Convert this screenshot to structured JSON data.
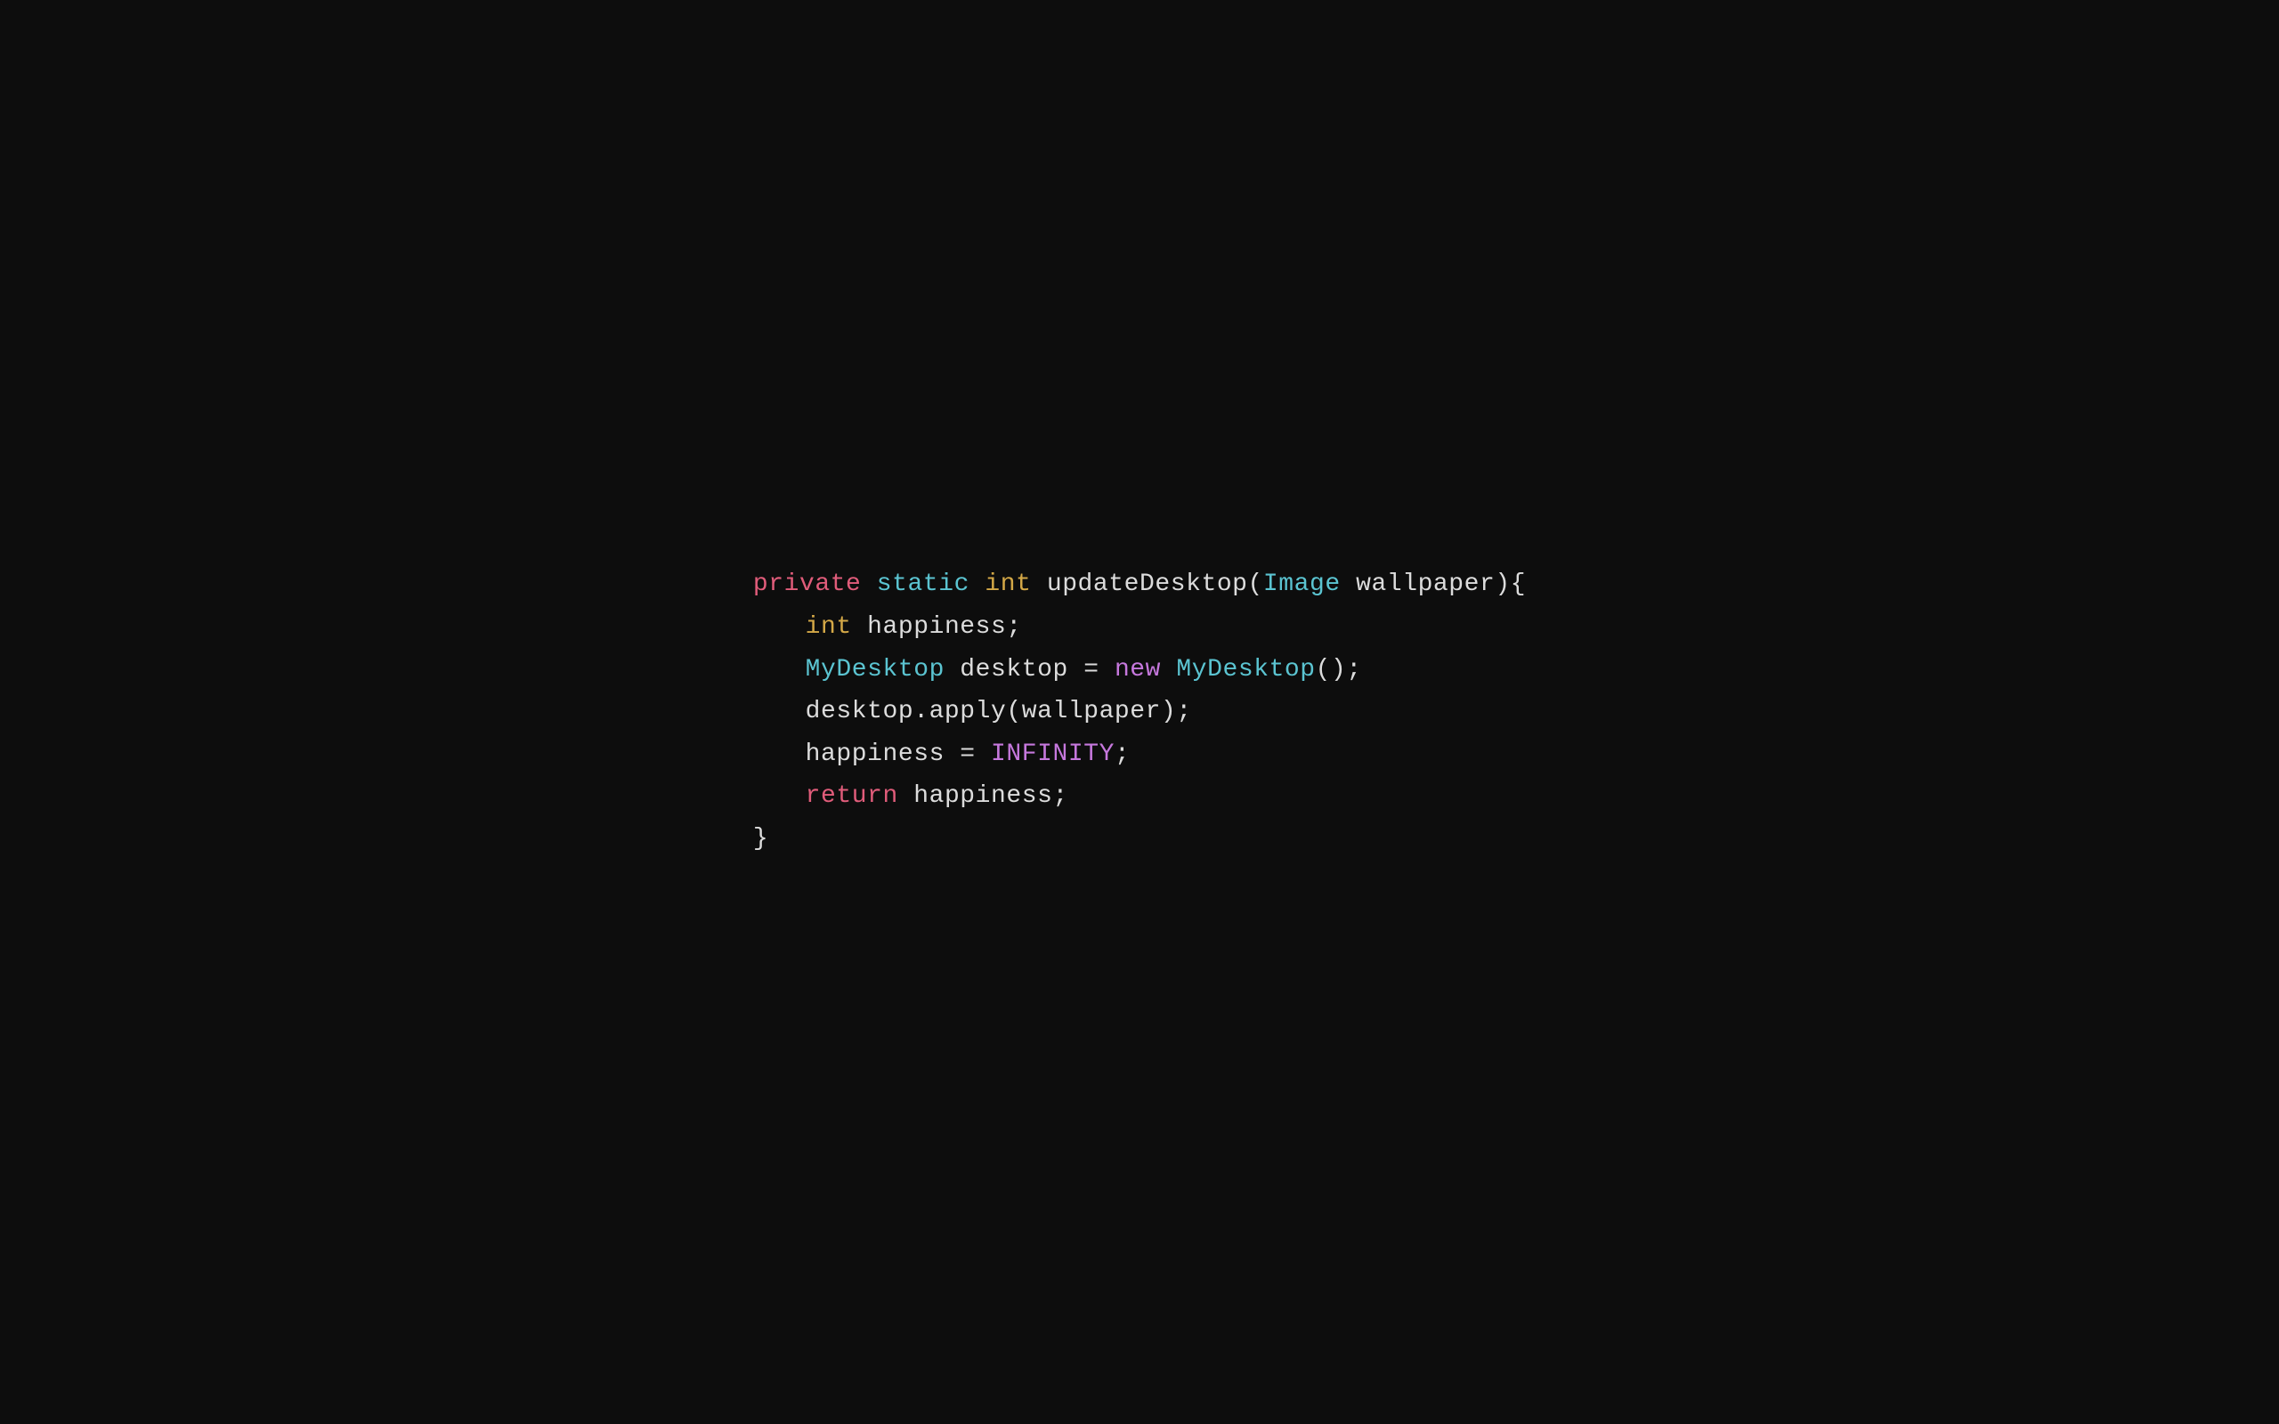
{
  "code": {
    "line1": {
      "private": "private",
      "static": "static",
      "int": "int",
      "method": "updateDesktop(",
      "param_type": "Image",
      "param_rest": " wallpaper){"
    },
    "line2": {
      "int_kw": "int",
      "rest": " happiness;"
    },
    "line3": {
      "class": "MyDesktop",
      "rest1": " desktop = ",
      "new_kw": "new",
      "class2": " MyDesktop",
      "rest2": "();"
    },
    "line4": {
      "text": "desktop.apply(wallpaper);"
    },
    "line5": {
      "text1": "happiness = ",
      "constant": "INFINITY",
      "text2": ";"
    },
    "line6": {
      "return_kw": "return",
      "rest": " happiness;"
    },
    "line7": {
      "text": "}"
    }
  }
}
